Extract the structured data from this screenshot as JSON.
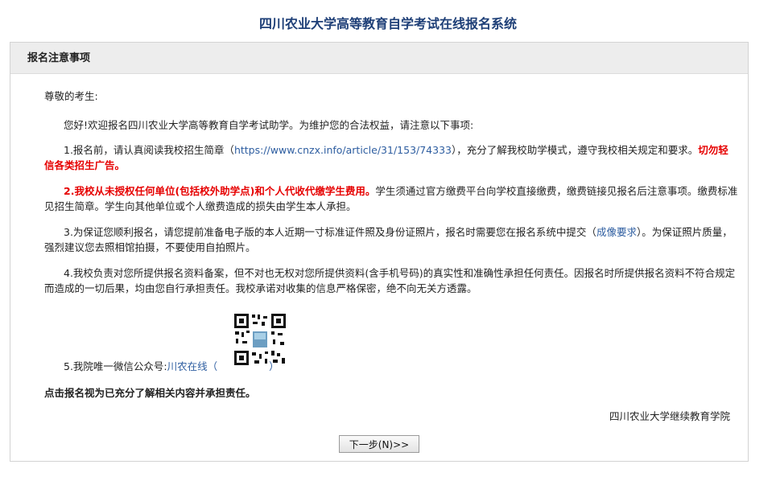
{
  "page": {
    "title": "四川农业大学高等教育自学考试在线报名系统"
  },
  "panel": {
    "header": "报名注意事项",
    "salutation": "尊敬的考生:",
    "intro": "您好!欢迎报名四川农业大学高等教育自学考试助学。为维护您的合法权益，请注意以下事项:",
    "item1": {
      "prefix": "1.报名前，请认真阅读我校招生简章（",
      "link": "https://www.cnzx.info/article/31/153/74333",
      "middle": "），充分了解我校助学模式，遵守我校相关规定和要求。",
      "warning": "切勿轻信各类招生广告。"
    },
    "item2": {
      "prefix": "2.",
      "warning": "我校从未授权任何单位(包括校外助学点)和个人代收代缴学生费用。",
      "rest": "学生须通过官方缴费平台向学校直接缴费，缴费链接见报名后注意事项。缴费标准见招生简章。学生向其他单位或个人缴费造成的损失由学生本人承担。"
    },
    "item3": {
      "prefix": "3.为保证您顺利报名，请您提前准备电子版的本人近期一寸标准证件照及身份证照片，报名时需要您在报名系统中提交（",
      "link": "成像要求",
      "suffix": "）。为保证照片质量，强烈建议您去照相馆拍摄，不要使用自拍照片。"
    },
    "item4": "4.我校负责对您所提供报名资料备案，但不对也无权对您所提供资料(含手机号码)的真实性和准确性承担任何责任。因报名时所提供报名资料不符合规定而造成的一切后果，均由您自行承担责任。我校承诺对收集的信息严格保密，绝不向无关方透露。",
    "item5": {
      "prefix": "5.我院唯一微信公众号:",
      "account": "川农在线",
      "paren_open": "（",
      "paren_close": "）"
    },
    "notice": "点击报名视为已充分了解相关内容并承担责任。",
    "signature": "四川农业大学继续教育学院",
    "next_button": "下一步(N)>>"
  }
}
